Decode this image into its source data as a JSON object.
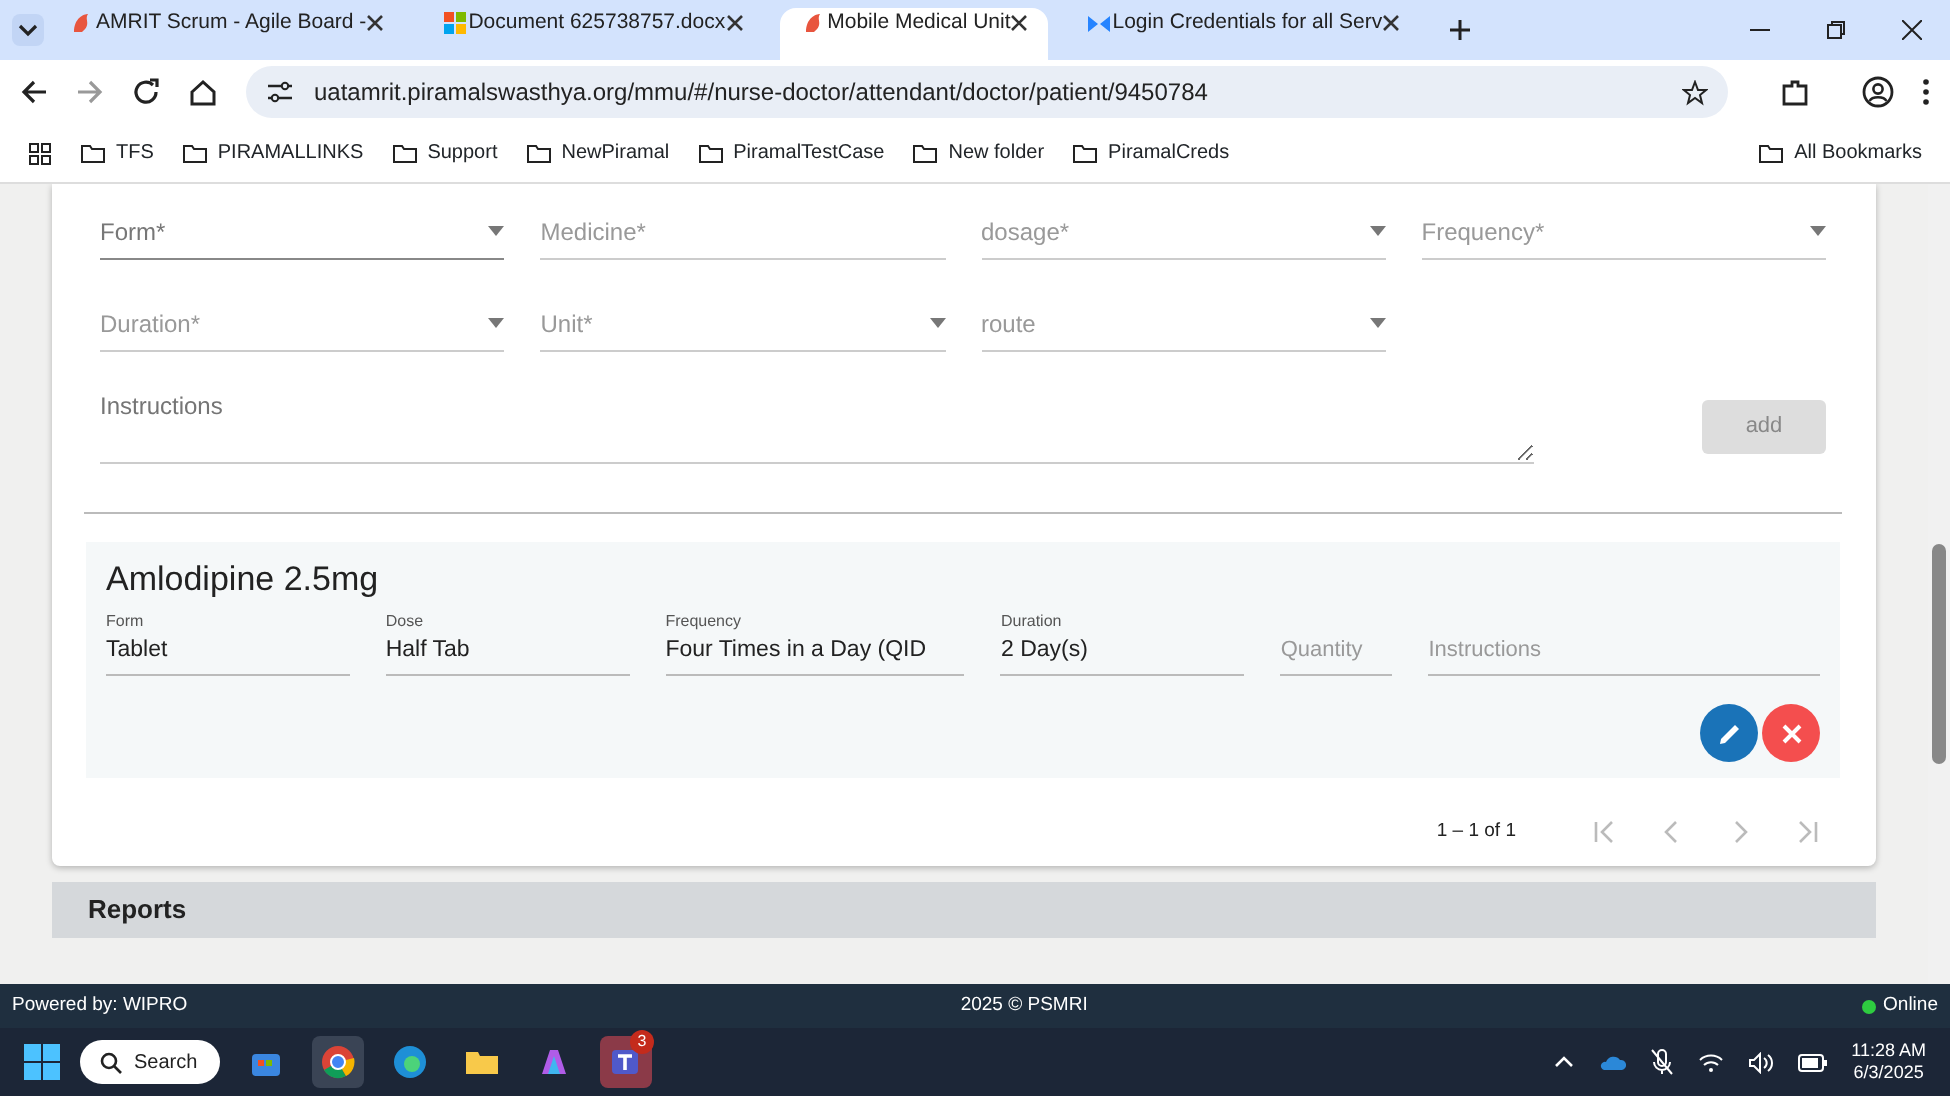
{
  "browser_tabs": [
    {
      "title": "AMRIT Scrum - Agile Board -",
      "selected": false
    },
    {
      "title": "Document 625738757.docx",
      "selected": false
    },
    {
      "title": "Mobile Medical Unit",
      "selected": true
    },
    {
      "title": "Login Credentials for all Serv",
      "selected": false
    }
  ],
  "address_bar": {
    "url": "uatamrit.piramalswasthya.org/mmu/#/nurse-doctor/attendant/doctor/patient/9450784"
  },
  "bookmarks": [
    "TFS",
    "PIRAMALLINKS",
    "Support",
    "NewPiramal",
    "PiramalTestCase",
    "New folder",
    "PiramalCreds"
  ],
  "all_bookmarks": "All Bookmarks",
  "prescription_form": {
    "rows": [
      [
        {
          "label": "Form*",
          "kind": "select",
          "focused": true
        },
        {
          "label": "Medicine*",
          "kind": "input",
          "focused": false
        },
        {
          "label": "dosage*",
          "kind": "select",
          "focused": false
        },
        {
          "label": "Frequency*",
          "kind": "select",
          "focused": false
        }
      ],
      [
        {
          "label": "Duration*",
          "kind": "select",
          "focused": false
        },
        {
          "label": "Unit*",
          "kind": "select",
          "focused": false
        },
        {
          "label": "route",
          "kind": "select",
          "focused": false
        }
      ]
    ],
    "instructions": {
      "placeholder": "Instructions"
    },
    "add_button": {
      "label": "add",
      "disabled": true
    }
  },
  "medicine_card": {
    "name": "Amlodipine 2.5mg",
    "fields": [
      {
        "label": "Form",
        "value": "Tablet"
      },
      {
        "label": "Dose",
        "value": "Half Tab"
      },
      {
        "label": "Frequency",
        "value": "Four Times in a Day (QID"
      },
      {
        "label": "Duration",
        "value": "2 Day(s)"
      },
      {
        "placeholder": "Quantity"
      },
      {
        "placeholder": "Instructions"
      }
    ]
  },
  "paginator": {
    "range": "1 – 1 of 1"
  },
  "next_section": {
    "title": "Reports"
  },
  "footer": {
    "left": "Powered by: WIPRO",
    "center": "2025 © PSMRI",
    "status": "Online",
    "online": true
  },
  "taskbar": {
    "search": "Search",
    "teams_badge": "3",
    "time": "11:28 AM",
    "date": "6/3/2025"
  }
}
